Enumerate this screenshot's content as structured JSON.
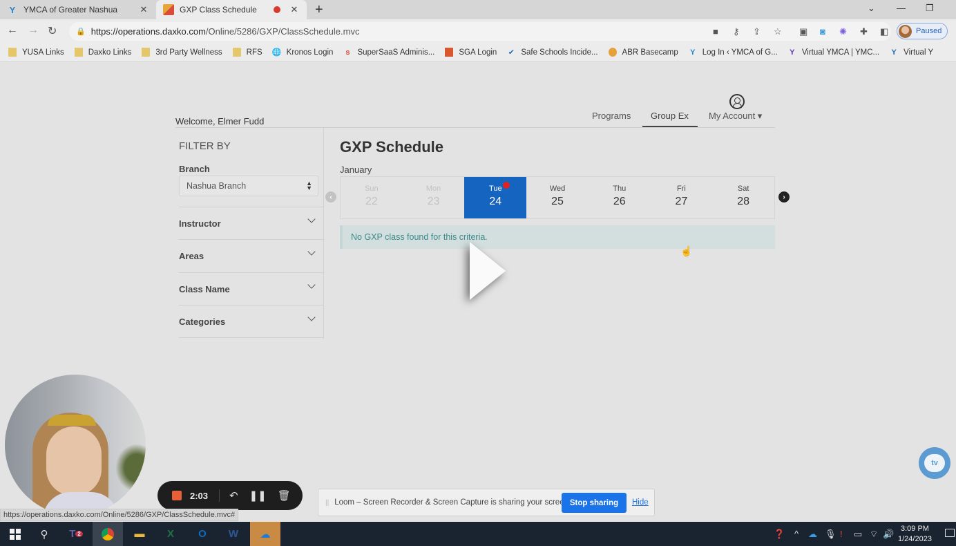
{
  "browser": {
    "tabs": [
      {
        "title": "YMCA of Greater Nashua",
        "favicon": "ymca-y-icon",
        "active": false
      },
      {
        "title": "GXP Class Schedule",
        "favicon": "gxp-logo-icon",
        "active": true,
        "recording": true
      }
    ],
    "url_host": "https://operations.daxko.com",
    "url_path": "/Online/5286/GXP/ClassSchedule.mvc",
    "profile_status": "Paused",
    "bookmarks": [
      {
        "label": "YUSA Links",
        "icon": "folder-icon"
      },
      {
        "label": "Daxko Links",
        "icon": "folder-icon"
      },
      {
        "label": "3rd Party Wellness",
        "icon": "folder-icon"
      },
      {
        "label": "RFS",
        "icon": "folder-icon"
      },
      {
        "label": "Kronos Login",
        "icon": "globe-icon"
      },
      {
        "label": "SuperSaaS Adminis...",
        "icon": "supersaas-icon"
      },
      {
        "label": "SGA Login",
        "icon": "sga-icon"
      },
      {
        "label": "Safe Schools Incide...",
        "icon": "check-icon"
      },
      {
        "label": "ABR Basecamp",
        "icon": "basecamp-icon"
      },
      {
        "label": "Log In ‹ YMCA of G...",
        "icon": "ymca-y-icon"
      },
      {
        "label": "Virtual YMCA | YMC...",
        "icon": "ymca-y-icon"
      },
      {
        "label": "Virtual Y",
        "icon": "ymca-y-icon"
      }
    ],
    "status_url": "https://operations.daxko.com/Online/5286/GXP/ClassSchedule.mvc#"
  },
  "header": {
    "welcome": "Welcome, Elmer Fudd",
    "nav": [
      {
        "label": "Programs",
        "active": false
      },
      {
        "label": "Group Ex",
        "active": true
      },
      {
        "label": "My Account ▾",
        "active": false
      }
    ]
  },
  "filters": {
    "heading": "FILTER BY",
    "branch_label": "Branch",
    "branch_value": "Nashua Branch",
    "sections": [
      "Instructor",
      "Areas",
      "Class Name",
      "Categories"
    ]
  },
  "schedule": {
    "title": "GXP Schedule",
    "month": "January",
    "days": [
      {
        "name": "Sun",
        "num": "22",
        "state": "past"
      },
      {
        "name": "Mon",
        "num": "23",
        "state": "past"
      },
      {
        "name": "Tue",
        "num": "24",
        "state": "selected"
      },
      {
        "name": "Wed",
        "num": "25",
        "state": "future"
      },
      {
        "name": "Thu",
        "num": "26",
        "state": "future"
      },
      {
        "name": "Fri",
        "num": "27",
        "state": "future"
      },
      {
        "name": "Sat",
        "num": "28",
        "state": "future"
      }
    ],
    "empty_message": "No GXP class found for this criteria."
  },
  "loom": {
    "elapsed": "2:03",
    "share_message": "Loom – Screen Recorder & Screen Capture is sharing your screen.",
    "stop_sharing": "Stop sharing",
    "hide": "Hide"
  },
  "widget": {
    "label": "tv"
  },
  "taskbar": {
    "time": "3:09 PM",
    "date": "1/24/2023",
    "teams_badge": "2"
  },
  "colors": {
    "selected_day": "#1565c0",
    "alert_text": "#3b8a8a",
    "stop_sharing_bg": "#1a73e8",
    "loom_record": "#e8603a"
  }
}
